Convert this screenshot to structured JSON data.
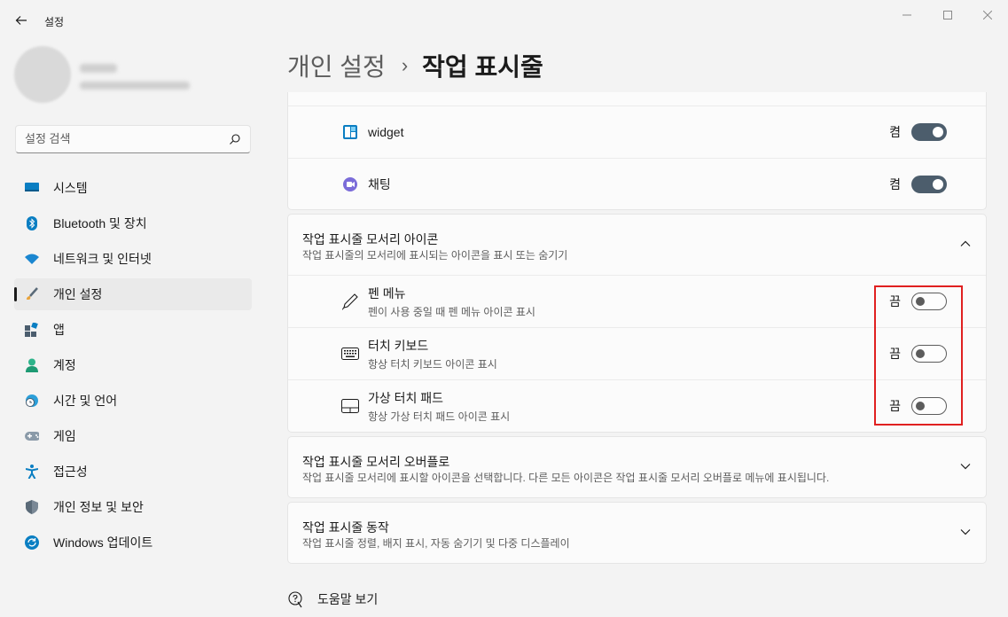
{
  "window": {
    "title": "설정",
    "controls": [
      "minimize",
      "maximize",
      "close"
    ]
  },
  "sidebar": {
    "search_placeholder": "설정 검색",
    "items": [
      {
        "label": "시스템",
        "icon": "system-icon"
      },
      {
        "label": "Bluetooth 및 장치",
        "icon": "bluetooth-icon"
      },
      {
        "label": "네트워크 및 인터넷",
        "icon": "wifi-icon"
      },
      {
        "label": "개인 설정",
        "icon": "brush-icon",
        "active": true
      },
      {
        "label": "앱",
        "icon": "apps-icon"
      },
      {
        "label": "계정",
        "icon": "account-icon"
      },
      {
        "label": "시간 및 언어",
        "icon": "clock-globe-icon"
      },
      {
        "label": "게임",
        "icon": "gamepad-icon"
      },
      {
        "label": "접근성",
        "icon": "accessibility-icon"
      },
      {
        "label": "개인 정보 및 보안",
        "icon": "shield-icon"
      },
      {
        "label": "Windows 업데이트",
        "icon": "update-icon"
      }
    ]
  },
  "breadcrumb": {
    "parent": "개인 설정",
    "separator": "›",
    "current": "작업 표시줄"
  },
  "taskbar_items": [
    {
      "label": "widget",
      "state": "켬",
      "on": true,
      "icon": "widget-icon"
    },
    {
      "label": "채팅",
      "state": "켬",
      "on": true,
      "icon": "chat-icon"
    }
  ],
  "corner_icons": {
    "title": "작업 표시줄 모서리 아이콘",
    "description": "작업 표시줄의 모서리에 표시되는 아이콘을 표시 또는 숨기기",
    "expanded": true,
    "items": [
      {
        "label": "펜 메뉴",
        "description": "펜이 사용 중일 때 펜 메뉴 아이콘 표시",
        "state": "끔",
        "on": false,
        "icon": "pen-icon"
      },
      {
        "label": "터치 키보드",
        "description": "항상 터치 키보드 아이콘 표시",
        "state": "끔",
        "on": false,
        "icon": "keyboard-icon"
      },
      {
        "label": "가상 터치 패드",
        "description": "항상 가상 터치 패드 아이콘 표시",
        "state": "끔",
        "on": false,
        "icon": "touchpad-icon"
      }
    ]
  },
  "overflow": {
    "title": "작업 표시줄 모서리 오버플로",
    "description": "작업 표시줄 모서리에 표시할 아이콘을 선택합니다. 다른 모든 아이콘은 작업 표시줄 모서리 오버플로 메뉴에 표시됩니다."
  },
  "behaviors": {
    "title": "작업 표시줄 동작",
    "description": "작업 표시줄 정렬, 배지 표시, 자동 숨기기 및 다중 디스플레이"
  },
  "help": {
    "label": "도움말 보기"
  },
  "colors": {
    "toggle_on": "#4c5d6c",
    "highlight": "#e02020",
    "accent_blue": "#0078d4"
  }
}
